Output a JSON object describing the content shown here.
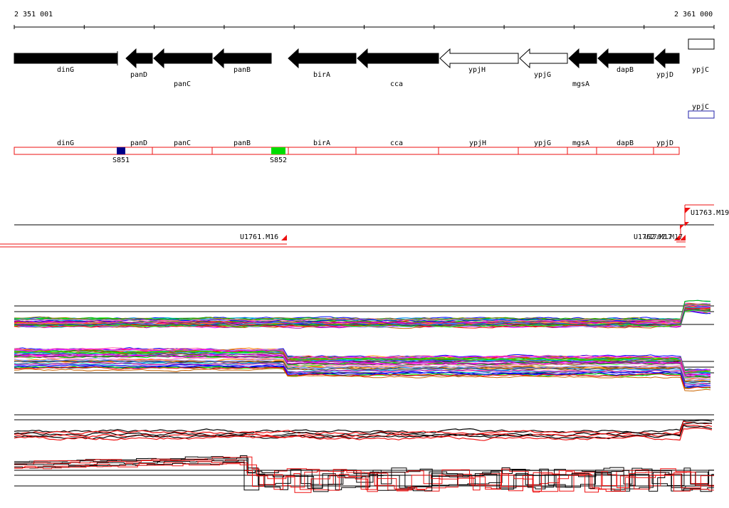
{
  "ruler": {
    "start_label": "2 351 001",
    "end_label": "2 361 000"
  },
  "genes": [
    {
      "name": "dinG",
      "strand": "+",
      "fill": "black"
    },
    {
      "name": "panD",
      "strand": "-",
      "fill": "black"
    },
    {
      "name": "panC",
      "strand": "-",
      "fill": "black"
    },
    {
      "name": "panB",
      "strand": "-",
      "fill": "black"
    },
    {
      "name": "birA",
      "strand": "-",
      "fill": "black"
    },
    {
      "name": "cca",
      "strand": "-",
      "fill": "black"
    },
    {
      "name": "ypjH",
      "strand": "-",
      "fill": "white"
    },
    {
      "name": "ypjG",
      "strand": "-",
      "fill": "white"
    },
    {
      "name": "mgsA",
      "strand": "-",
      "fill": "black"
    },
    {
      "name": "dapB",
      "strand": "-",
      "fill": "black"
    },
    {
      "name": "ypjD",
      "strand": "-",
      "fill": "black"
    },
    {
      "name": "ypjC",
      "strand": "+",
      "fill": "white"
    }
  ],
  "secondary_track": {
    "label": "ypjC",
    "color": "#2222aa"
  },
  "feature_track": {
    "labels": [
      "dinG",
      "panD",
      "panC",
      "panB",
      "birA",
      "cca",
      "ypjH",
      "ypjG",
      "mgsA",
      "dapB",
      "ypjD"
    ],
    "markers": [
      {
        "name": "S851",
        "color": "#000088"
      },
      {
        "name": "S852",
        "color": "#00dd00"
      }
    ]
  },
  "transcript_track": {
    "labels": [
      "U1761.M16",
      "U1762.M17",
      "U1763.M19"
    ]
  },
  "colors": {
    "accent_red": "#ee1111",
    "marker_blue": "#000088",
    "marker_green": "#00dd00",
    "track_blue": "#2222aa"
  }
}
